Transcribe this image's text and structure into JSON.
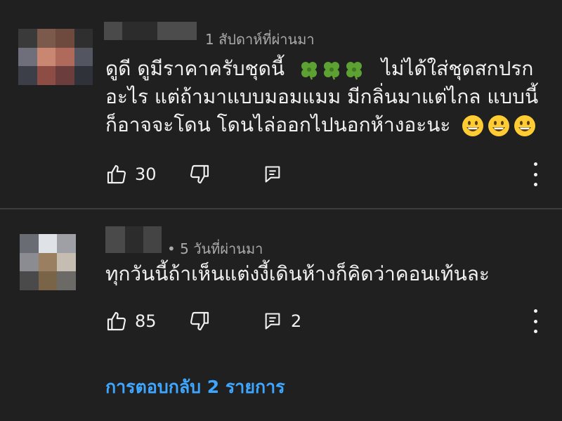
{
  "comments": [
    {
      "time": "1 สัปดาห์ที่ผ่านมา",
      "text_lines": [
        "ดูดี ดูมีราคาครับชุดนี้",
        "ไม่ได้ใส่ชุดสกปรก",
        "อะไร แต่ถ้ามาแบบมอมแมม มีกลิ่นมาแต่ไกล แบบนี้",
        "ก็อาจจะโดน โดนไล่ออกไปนอกห้างอะนะ"
      ],
      "emojis": [
        "four-leaf-clover",
        "grinning-face"
      ],
      "likes": "30",
      "reply_count": ""
    },
    {
      "time": "• 5 วันที่ผ่านมา",
      "text_lines": [
        "ทุกวันนี้ถ้าเห็นแต่งงี้เดินห้างก็คิดว่าคอนเท้นละ"
      ],
      "likes": "85",
      "reply_count": "2"
    }
  ],
  "replies_link": "การตอบกลับ 2 รายการ",
  "colors": {
    "background": "#202020",
    "text": "#f1f1f1",
    "meta": "#aaaaaa",
    "link": "#3ea6ff",
    "divider": "#3d3d3d"
  },
  "icons": [
    "like-icon",
    "dislike-icon",
    "reply-icon",
    "more-options-icon"
  ]
}
